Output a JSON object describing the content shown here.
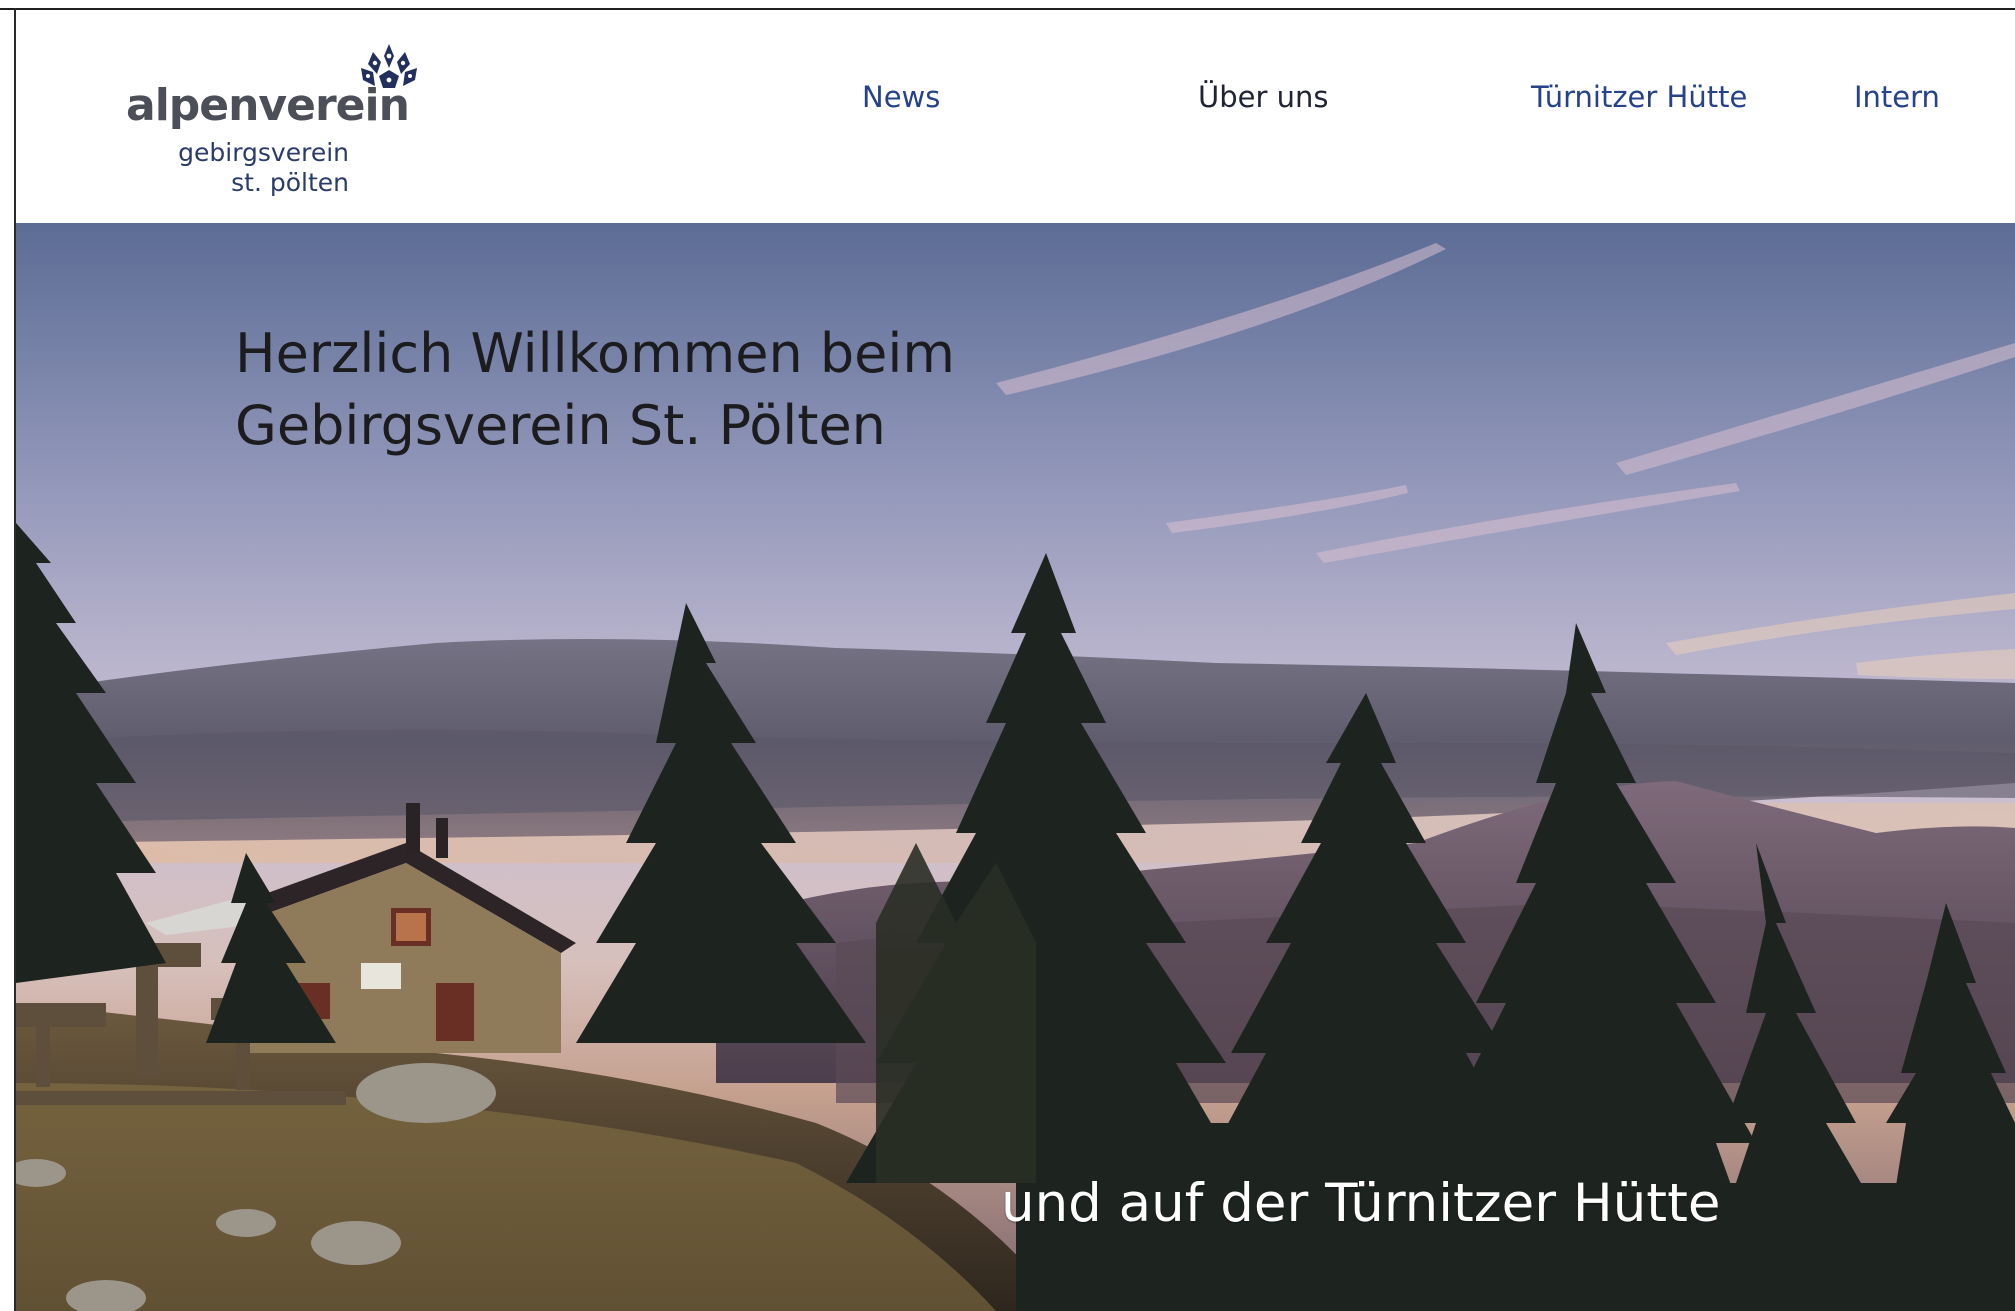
{
  "logo": {
    "main": "alpenverein",
    "line1": "gebirgsverein",
    "line2": "st. pölten",
    "icon": "edelweiss-icon"
  },
  "nav": {
    "news": "News",
    "about": "Über uns",
    "hut": "Türnitzer Hütte",
    "intern": "Intern"
  },
  "hero": {
    "title_line1": "Herzlich Willkommen beim",
    "title_line2": "Gebirgsverein St. Pölten",
    "subtitle": "und auf der Türnitzer Hütte",
    "image": "mountain-hut-sunset-photo"
  },
  "colors": {
    "nav_accent": "#25428a",
    "nav_active": "#1f2333",
    "logo_grey": "#4c4f58",
    "logo_blue": "#2b3c6b"
  }
}
